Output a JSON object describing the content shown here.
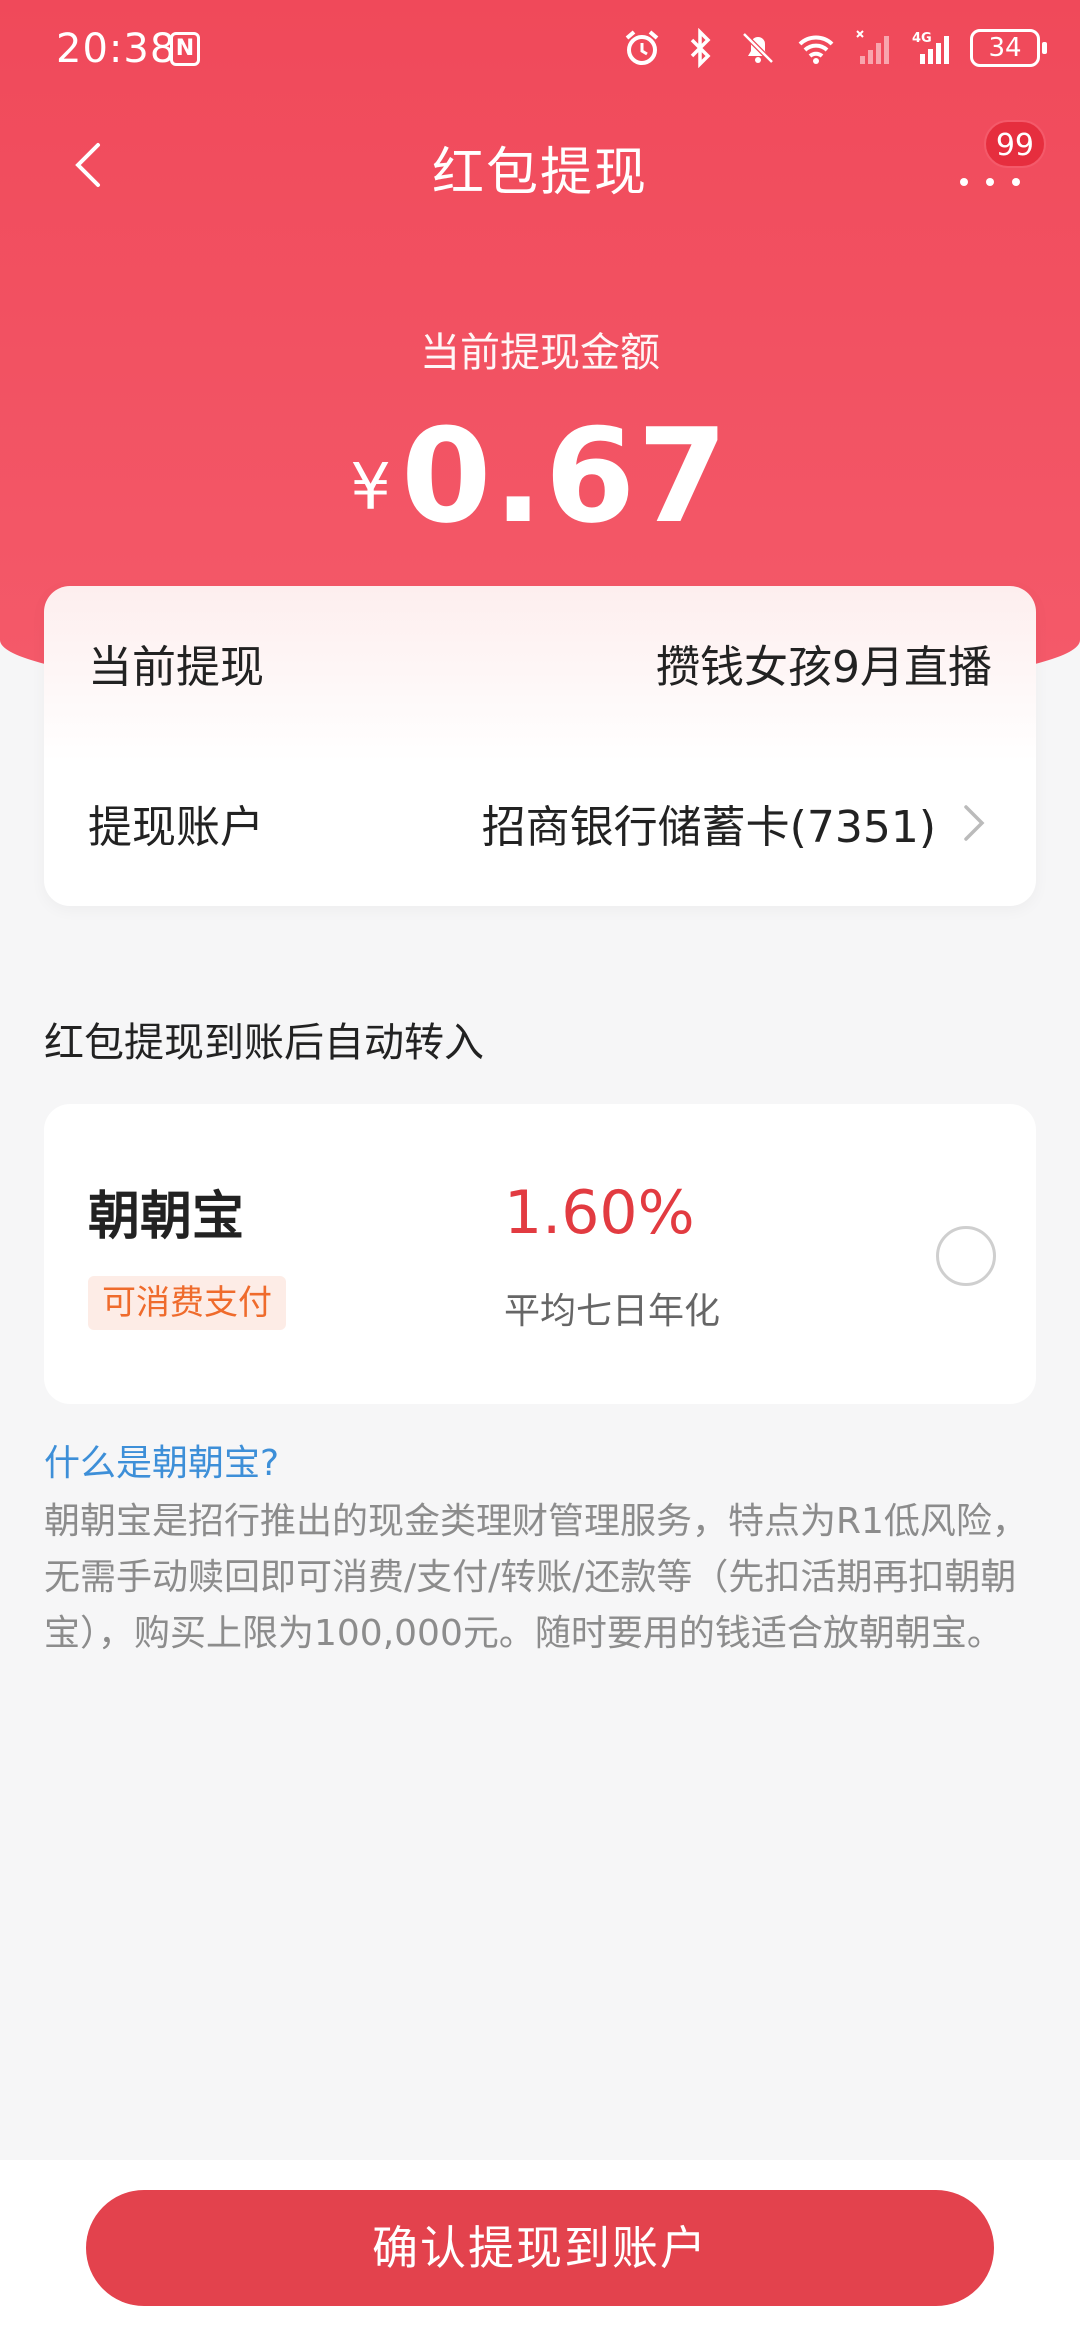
{
  "status_bar": {
    "time": "20:38",
    "nfc_letter": "N",
    "battery": "34"
  },
  "nav": {
    "title": "红包提现",
    "badge": "99"
  },
  "amount": {
    "label": "当前提现金额",
    "currency": "¥",
    "value": "0.67"
  },
  "info": {
    "current_label": "当前提现",
    "current_value": "攒钱女孩9月直播",
    "account_label": "提现账户",
    "account_value": "招商银行储蓄卡(7351)"
  },
  "auto_transfer": {
    "title": "红包提现到账后自动转入",
    "product_name": "朝朝宝",
    "tag": "可消费支付",
    "rate": "1.60%",
    "rate_label": "平均七日年化"
  },
  "help": {
    "link": "什么是朝朝宝?",
    "description": "朝朝宝是招行推出的现金类理财管理服务，特点为R1低风险，无需手动赎回即可消费/支付/转账/还款等（先扣活期再扣朝朝宝），购买上限为100,000元。随时要用的钱适合放朝朝宝。"
  },
  "confirm_button": "确认提现到账户",
  "colors": {
    "brand_red": "#f0495a",
    "button_red": "#e3424d",
    "rate_red": "#e23b41",
    "link_blue": "#3d8fd8",
    "tag_orange": "#ef6b2c"
  }
}
